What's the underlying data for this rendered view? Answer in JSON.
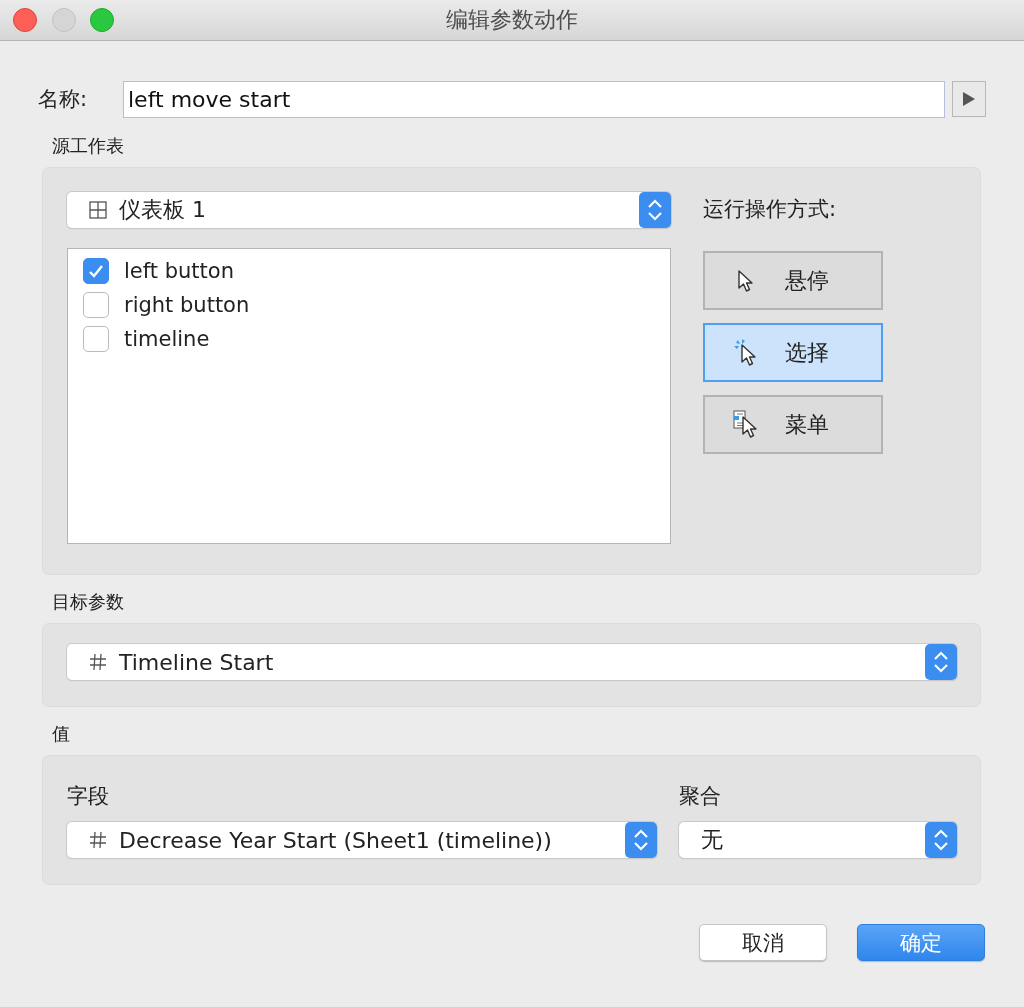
{
  "window": {
    "title": "编辑参数动作"
  },
  "name": {
    "label": "名称:",
    "value": "left move start"
  },
  "source_sheets": {
    "label": "源工作表",
    "dropdown": {
      "kind": "dashboard",
      "value": "仪表板 1"
    },
    "sheets": [
      {
        "label": "left button",
        "checked": true
      },
      {
        "label": "right button",
        "checked": false
      },
      {
        "label": "timeline",
        "checked": false
      }
    ],
    "run_action_label": "运行操作方式:",
    "run_modes": [
      {
        "kind": "hover",
        "label": "悬停",
        "selected": false
      },
      {
        "kind": "select",
        "label": "选择",
        "selected": true
      },
      {
        "kind": "menu",
        "label": "菜单",
        "selected": false
      }
    ]
  },
  "target_parameter": {
    "label": "目标参数",
    "dropdown": {
      "kind": "number",
      "value": "Timeline Start"
    }
  },
  "value": {
    "label": "值",
    "field": {
      "label": "字段",
      "dropdown": {
        "kind": "number",
        "value": "Decrease Year Start (Sheet1 (timeline))"
      }
    },
    "aggregation": {
      "label": "聚合",
      "dropdown": {
        "value": "无"
      }
    }
  },
  "buttons": [
    {
      "label": "取消",
      "default": false
    },
    {
      "label": "确定",
      "default": true
    }
  ]
}
